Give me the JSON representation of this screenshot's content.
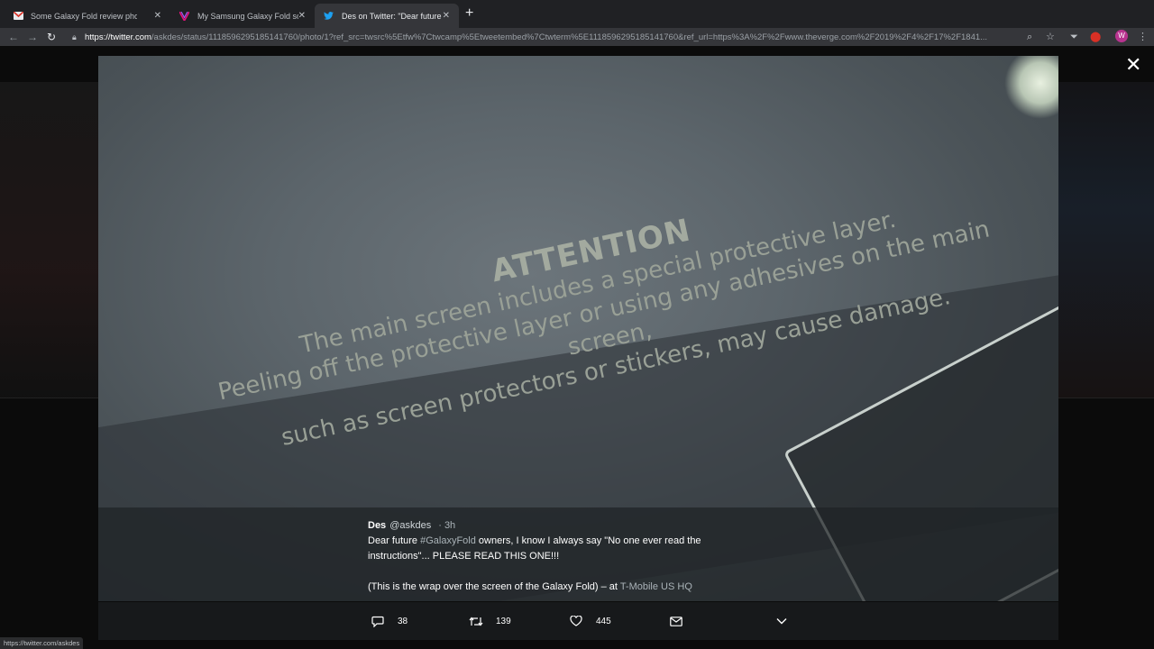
{
  "tabs": [
    {
      "title": "Some Galaxy Fold review pho...",
      "icon": "gmail-icon"
    },
    {
      "title": "My Samsung Galaxy Fold scre...",
      "icon": "verge-icon"
    },
    {
      "title": "Des on Twitter: \"Dear future #...\"",
      "icon": "twitter-icon"
    }
  ],
  "address": {
    "host": "https://twitter.com",
    "rest": "/askdes/status/1118596295185141760/photo/1?ref_src=twsrc%5Etfw%7Ctwcamp%5Etweetembed%7Ctwterm%5E1118596295185141760&ref_url=https%3A%2F%2Fwww.theverge.com%2F2019%2F4%2F17%2F1841..."
  },
  "profile_initial": "W",
  "photo_text": {
    "heading": "ATTENTION",
    "line1": "The main screen includes a special protective layer.",
    "line2": "Peeling off the protective layer or using any adhesives on the main screen,",
    "line3": "such as screen protectors or stickers, may cause damage."
  },
  "tweet": {
    "name": "Des",
    "handle": "@askdes",
    "time": "· 3h",
    "text_before": "Dear future ",
    "hashtag": "#GalaxyFold",
    "text_after": " owners, I know I always say \"No one ever read the instructions\"... PLEASE READ THIS ONE!!!",
    "line2": "(This is the wrap over the screen of the Galaxy Fold) – at ",
    "place": "T-Mobile US HQ"
  },
  "actions": {
    "replies": "38",
    "retweets": "139",
    "likes": "445"
  },
  "status_url": "https://twitter.com/askdes"
}
